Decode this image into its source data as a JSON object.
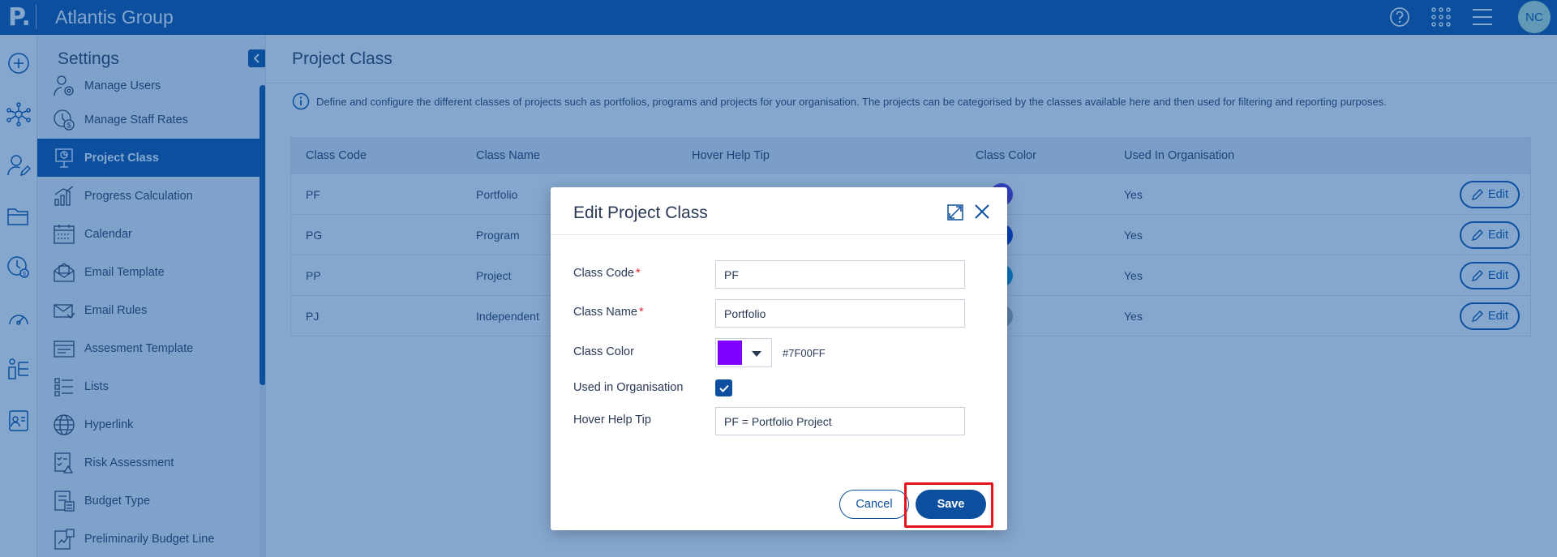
{
  "app": {
    "logo": "P.",
    "title": "Atlantis Group",
    "avatar_initials": "NC"
  },
  "topbar_icons": [
    "help-icon",
    "apps-grid-icon",
    "hamburger-menu-icon"
  ],
  "rail_icons": [
    "add-icon",
    "network-icon",
    "user-edit-icon",
    "folder-icon",
    "timesheet-icon",
    "dashboard-icon",
    "org-chart-icon",
    "id-card-icon"
  ],
  "settings": {
    "title": "Settings",
    "items": [
      {
        "label": "Manage Users",
        "icon": "user-settings-icon",
        "active": false
      },
      {
        "label": "Manage Staff Rates",
        "icon": "staff-rates-icon",
        "active": false
      },
      {
        "label": "Project Class",
        "icon": "presentation-icon",
        "active": true
      },
      {
        "label": "Progress Calculation",
        "icon": "bar-chart-icon",
        "active": false
      },
      {
        "label": "Calendar",
        "icon": "calendar-icon",
        "active": false
      },
      {
        "label": "Email Template",
        "icon": "email-template-icon",
        "active": false
      },
      {
        "label": "Email Rules",
        "icon": "email-rules-icon",
        "active": false
      },
      {
        "label": "Assesment Template",
        "icon": "template-icon",
        "active": false
      },
      {
        "label": "Lists",
        "icon": "list-icon",
        "active": false
      },
      {
        "label": "Hyperlink",
        "icon": "globe-icon",
        "active": false
      },
      {
        "label": "Risk Assessment",
        "icon": "risk-icon",
        "active": false
      },
      {
        "label": "Budget Type",
        "icon": "budget-icon",
        "active": false
      },
      {
        "label": "Preliminarily Budget Line",
        "icon": "budget-line-icon",
        "active": false
      }
    ]
  },
  "main": {
    "title": "Project Class",
    "info": "Define and configure the different classes of projects such as portfolios, programs and projects for your organisation. The projects can be categorised by the classes available here and then used for filtering and reporting purposes.",
    "columns": [
      "Class Code",
      "Class Name",
      "Hover Help Tip",
      "Class Color",
      "Used In Organisation"
    ],
    "rows": [
      {
        "code": "PF",
        "name": "Portfolio",
        "color": "#5a35d8",
        "used": "Yes",
        "edit": "Edit"
      },
      {
        "code": "PG",
        "name": "Program",
        "color": "#0733cf",
        "used": "Yes",
        "edit": "Edit"
      },
      {
        "code": "PP",
        "name": "Project",
        "color": "#1296d8",
        "used": "Yes",
        "edit": "Edit"
      },
      {
        "code": "PJ",
        "name": "Independent",
        "color": "#a9b0b8",
        "used": "Yes",
        "edit": "Edit"
      }
    ]
  },
  "modal": {
    "title": "Edit Project Class",
    "fields": {
      "class_code_label": "Class Code",
      "class_code_value": "PF",
      "class_name_label": "Class Name",
      "class_name_value": "Portfolio",
      "class_color_label": "Class Color",
      "class_color_hex": "#7F00FF",
      "used_label": "Used in Organisation",
      "used_checked": true,
      "hover_label": "Hover Help Tip",
      "hover_value": "PF = Portfolio Project"
    },
    "required_mark": "*",
    "cancel_label": "Cancel",
    "save_label": "Save"
  },
  "colors": {
    "brand": "#0b4f9e",
    "overlay": "rgba(11,79,158,0.5)",
    "highlight": "#e5141b",
    "selected_color": "#7f00ff"
  }
}
